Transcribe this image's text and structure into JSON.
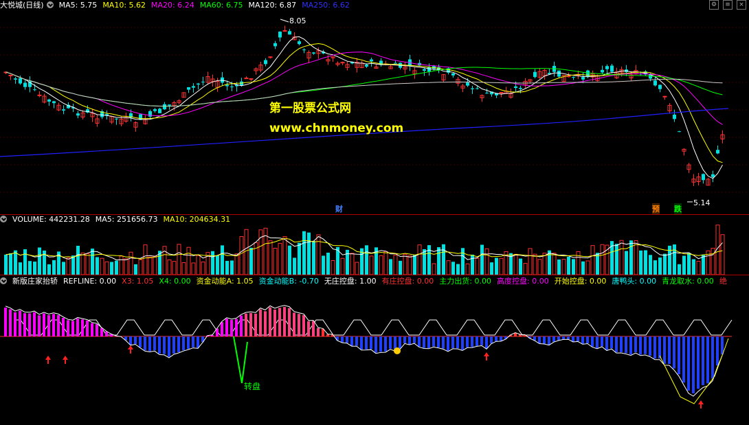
{
  "main": {
    "stock": "大悦城(日线)",
    "ma_labels": [
      {
        "text": "MA5: 5.75",
        "color": "#ffffff"
      },
      {
        "text": "MA10: 5.62",
        "color": "#ffff00"
      },
      {
        "text": "MA20: 6.24",
        "color": "#ff00ff"
      },
      {
        "text": "MA60: 6.75",
        "color": "#00ff00"
      },
      {
        "text": "MA120: 6.87",
        "color": "#ffffff"
      },
      {
        "text": "MA250: 6.62",
        "color": "#3030ff"
      }
    ],
    "high_label": "8.05",
    "low_label": "5.14",
    "watermark_cn": "第一股票公式网",
    "watermark_url": "www.chnmoney.com",
    "event_tags": [
      {
        "text": "财",
        "color": "#4080ff"
      },
      {
        "text": "预",
        "color": "#ff8000"
      },
      {
        "text": "跌",
        "color": "#00ff00"
      }
    ]
  },
  "volume": {
    "labels": [
      {
        "text": "VOLUME: 442231.28",
        "color": "#ffffff"
      },
      {
        "text": "MA5: 251656.73",
        "color": "#ffffff"
      },
      {
        "text": "MA10: 204634.31",
        "color": "#ffff00"
      }
    ]
  },
  "indicator": {
    "labels": [
      {
        "text": "新版庄家抬轿",
        "color": "#ffffff"
      },
      {
        "text": "REFLINE: 0.00",
        "color": "#ffffff"
      },
      {
        "text": "X3: 1.05",
        "color": "#ff3030"
      },
      {
        "text": "X4: 0.00",
        "color": "#00ff00"
      },
      {
        "text": "资金动能A: 1.05",
        "color": "#ffff00"
      },
      {
        "text": "资金动能B: -0.70",
        "color": "#00ffff"
      },
      {
        "text": "无庄控盘: 1.00",
        "color": "#ffffff"
      },
      {
        "text": "有庄控盘: 0.00",
        "color": "#ff3030"
      },
      {
        "text": "主力出货: 0.00",
        "color": "#00ff00"
      },
      {
        "text": "高度控盘: 0.00",
        "color": "#ff00ff"
      },
      {
        "text": "开始控盘: 0.00",
        "color": "#ffff00"
      },
      {
        "text": "唐鸭头: 0.00",
        "color": "#00ffff"
      },
      {
        "text": "青龙取水: 0.00",
        "color": "#00ff00"
      },
      {
        "text": "绝",
        "color": "#ff3030"
      }
    ],
    "zhuanpan_label": "转盘"
  }
}
